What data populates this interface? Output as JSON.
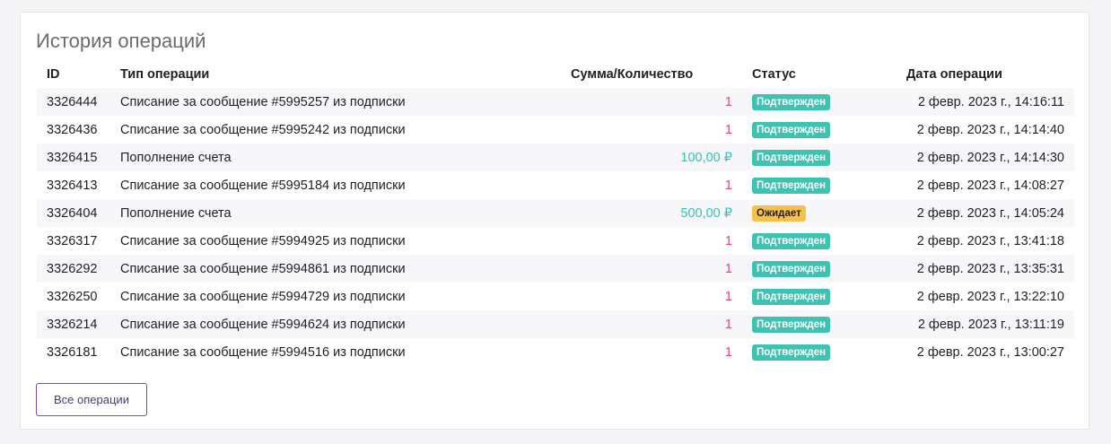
{
  "panel": {
    "title": "История операций",
    "all_button_label": "Все операции"
  },
  "table": {
    "headers": {
      "id": "ID",
      "type": "Тип операции",
      "amount": "Сумма/Количество",
      "status": "Статус",
      "date": "Дата операции"
    },
    "rows": [
      {
        "id": "3326444",
        "type": "Списание за сообщение #5995257 из подписки",
        "amount": "1",
        "kind": "debit",
        "status": "Подтвержден",
        "status_kind": "ok",
        "date": "2 февр. 2023 г., 14:16:11"
      },
      {
        "id": "3326436",
        "type": "Списание за сообщение #5995242 из подписки",
        "amount": "1",
        "kind": "debit",
        "status": "Подтвержден",
        "status_kind": "ok",
        "date": "2 февр. 2023 г., 14:14:40"
      },
      {
        "id": "3326415",
        "type": "Пополнение счета",
        "amount": "100,00 ₽",
        "kind": "credit",
        "status": "Подтвержден",
        "status_kind": "ok",
        "date": "2 февр. 2023 г., 14:14:30"
      },
      {
        "id": "3326413",
        "type": "Списание за сообщение #5995184 из подписки",
        "amount": "1",
        "kind": "debit",
        "status": "Подтвержден",
        "status_kind": "ok",
        "date": "2 февр. 2023 г., 14:08:27"
      },
      {
        "id": "3326404",
        "type": "Пополнение счета",
        "amount": "500,00 ₽",
        "kind": "credit",
        "status": "Ожидает",
        "status_kind": "wait",
        "date": "2 февр. 2023 г., 14:05:24"
      },
      {
        "id": "3326317",
        "type": "Списание за сообщение #5994925 из подписки",
        "amount": "1",
        "kind": "debit",
        "status": "Подтвержден",
        "status_kind": "ok",
        "date": "2 февр. 2023 г., 13:41:18"
      },
      {
        "id": "3326292",
        "type": "Списание за сообщение #5994861 из подписки",
        "amount": "1",
        "kind": "debit",
        "status": "Подтвержден",
        "status_kind": "ok",
        "date": "2 февр. 2023 г., 13:35:31"
      },
      {
        "id": "3326250",
        "type": "Списание за сообщение #5994729 из подписки",
        "amount": "1",
        "kind": "debit",
        "status": "Подтвержден",
        "status_kind": "ok",
        "date": "2 февр. 2023 г., 13:22:10"
      },
      {
        "id": "3326214",
        "type": "Списание за сообщение #5994624 из подписки",
        "amount": "1",
        "kind": "debit",
        "status": "Подтвержден",
        "status_kind": "ok",
        "date": "2 февр. 2023 г., 13:11:19"
      },
      {
        "id": "3326181",
        "type": "Списание за сообщение #5994516 из подписки",
        "amount": "1",
        "kind": "debit",
        "status": "Подтвержден",
        "status_kind": "ok",
        "date": "2 февр. 2023 г., 13:00:27"
      }
    ]
  },
  "colors": {
    "debit": "#e0457b",
    "credit": "#2ec4b6",
    "status_ok": "#3ec3b3",
    "status_wait": "#f7c04a",
    "button_border": "#7a4bb0"
  }
}
